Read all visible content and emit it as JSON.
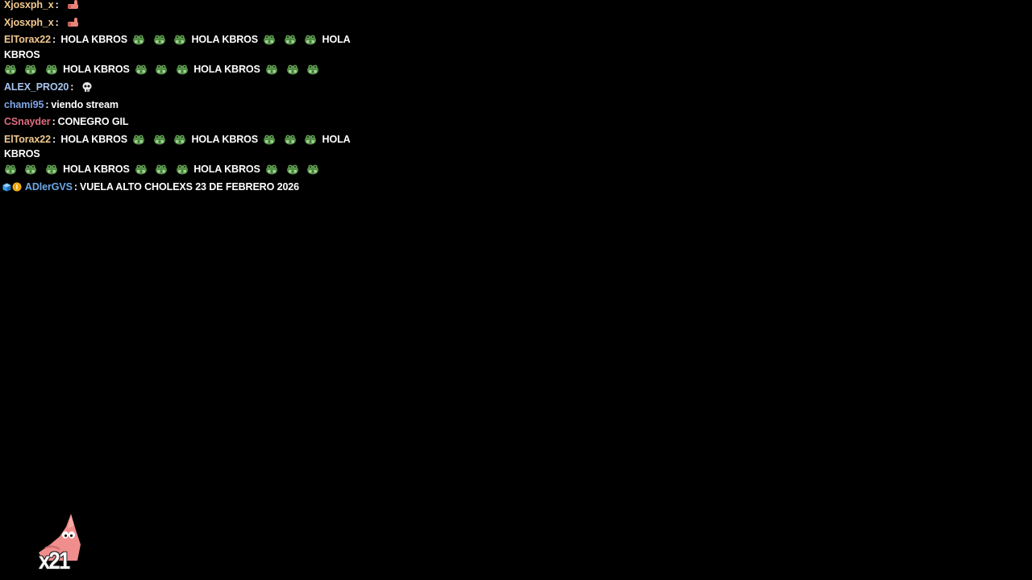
{
  "colors": {
    "background": "#000000",
    "message_text": "#ffffff",
    "user_xjosxph": "#f2c98f",
    "user_eltorax": "#f2c98f",
    "user_alex": "#a9c5f0",
    "user_chami": "#7fa6e6",
    "user_csnayder": "#e06b7f",
    "user_adler": "#6fa8e8"
  },
  "chat": {
    "separator": ":",
    "messages": [
      {
        "user": "Xjosxph_x",
        "emote": "finger-pointing-emote"
      },
      {
        "user": "Xjosxph_x",
        "emote": "finger-pointing-emote"
      },
      {
        "user": "ElTorax22",
        "text": "HOLA KBROS",
        "emote": "frog-money-emote"
      },
      {
        "user": "ALEX_PRO20",
        "emote": "skull-emote"
      },
      {
        "user": "chami95",
        "text": "viendo stream"
      },
      {
        "user": "CSnayder",
        "text": "CONEGRO GIL"
      },
      {
        "user": "ElTorax22",
        "text": "HOLA KBROS",
        "emote": "frog-money-emote"
      },
      {
        "user": "ADlerGVS",
        "text": "VUELA ALTO CHOLEXS 23 DE FEBRERO 2026",
        "badges": [
          "cube-badge",
          "gold-coin-badge"
        ]
      }
    ]
  },
  "overlay": {
    "icon": "patrick-star-icon",
    "count": "x21"
  }
}
